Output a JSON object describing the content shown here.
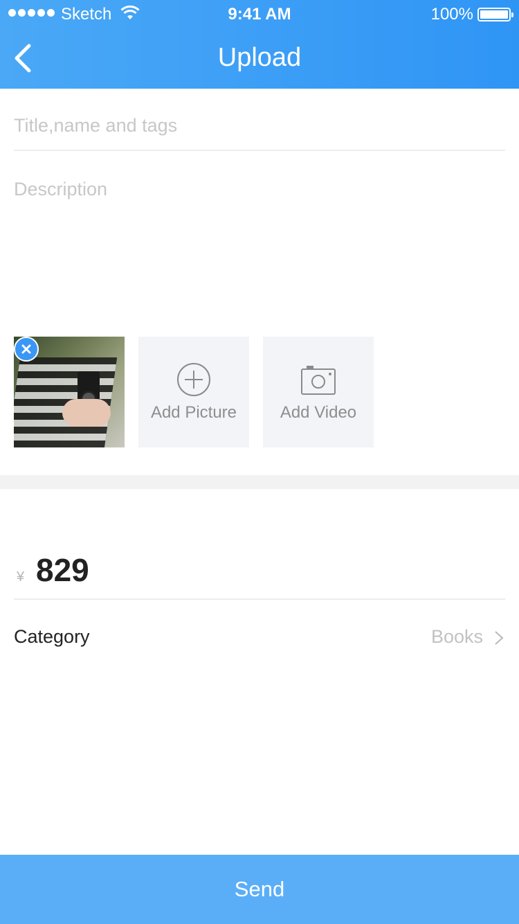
{
  "status_bar": {
    "carrier": "Sketch",
    "time": "9:41 AM",
    "battery": "100%",
    "wifi_icon": "wifi-icon",
    "battery_icon": "battery-icon"
  },
  "nav": {
    "title": "Upload",
    "back_icon": "chevron-left-icon"
  },
  "form": {
    "title_placeholder": "Title,name and tags",
    "description_placeholder": "Description"
  },
  "media": {
    "photo_alt": "photo-thumbnail",
    "add_picture_label": "Add Picture",
    "add_video_label": "Add Video",
    "add_picture_icon": "plus-circle-icon",
    "add_video_icon": "camera-icon",
    "remove_icon": "close-icon"
  },
  "price": {
    "currency": "¥",
    "value": "829"
  },
  "category": {
    "label": "Category",
    "value": "Books",
    "chevron_icon": "chevron-right-icon"
  },
  "send": {
    "label": "Send"
  },
  "colors": {
    "header_start": "#4aa8f6",
    "header_end": "#2f95f5",
    "send_button": "#5aaef7",
    "remove_badge": "#3a97f5"
  }
}
